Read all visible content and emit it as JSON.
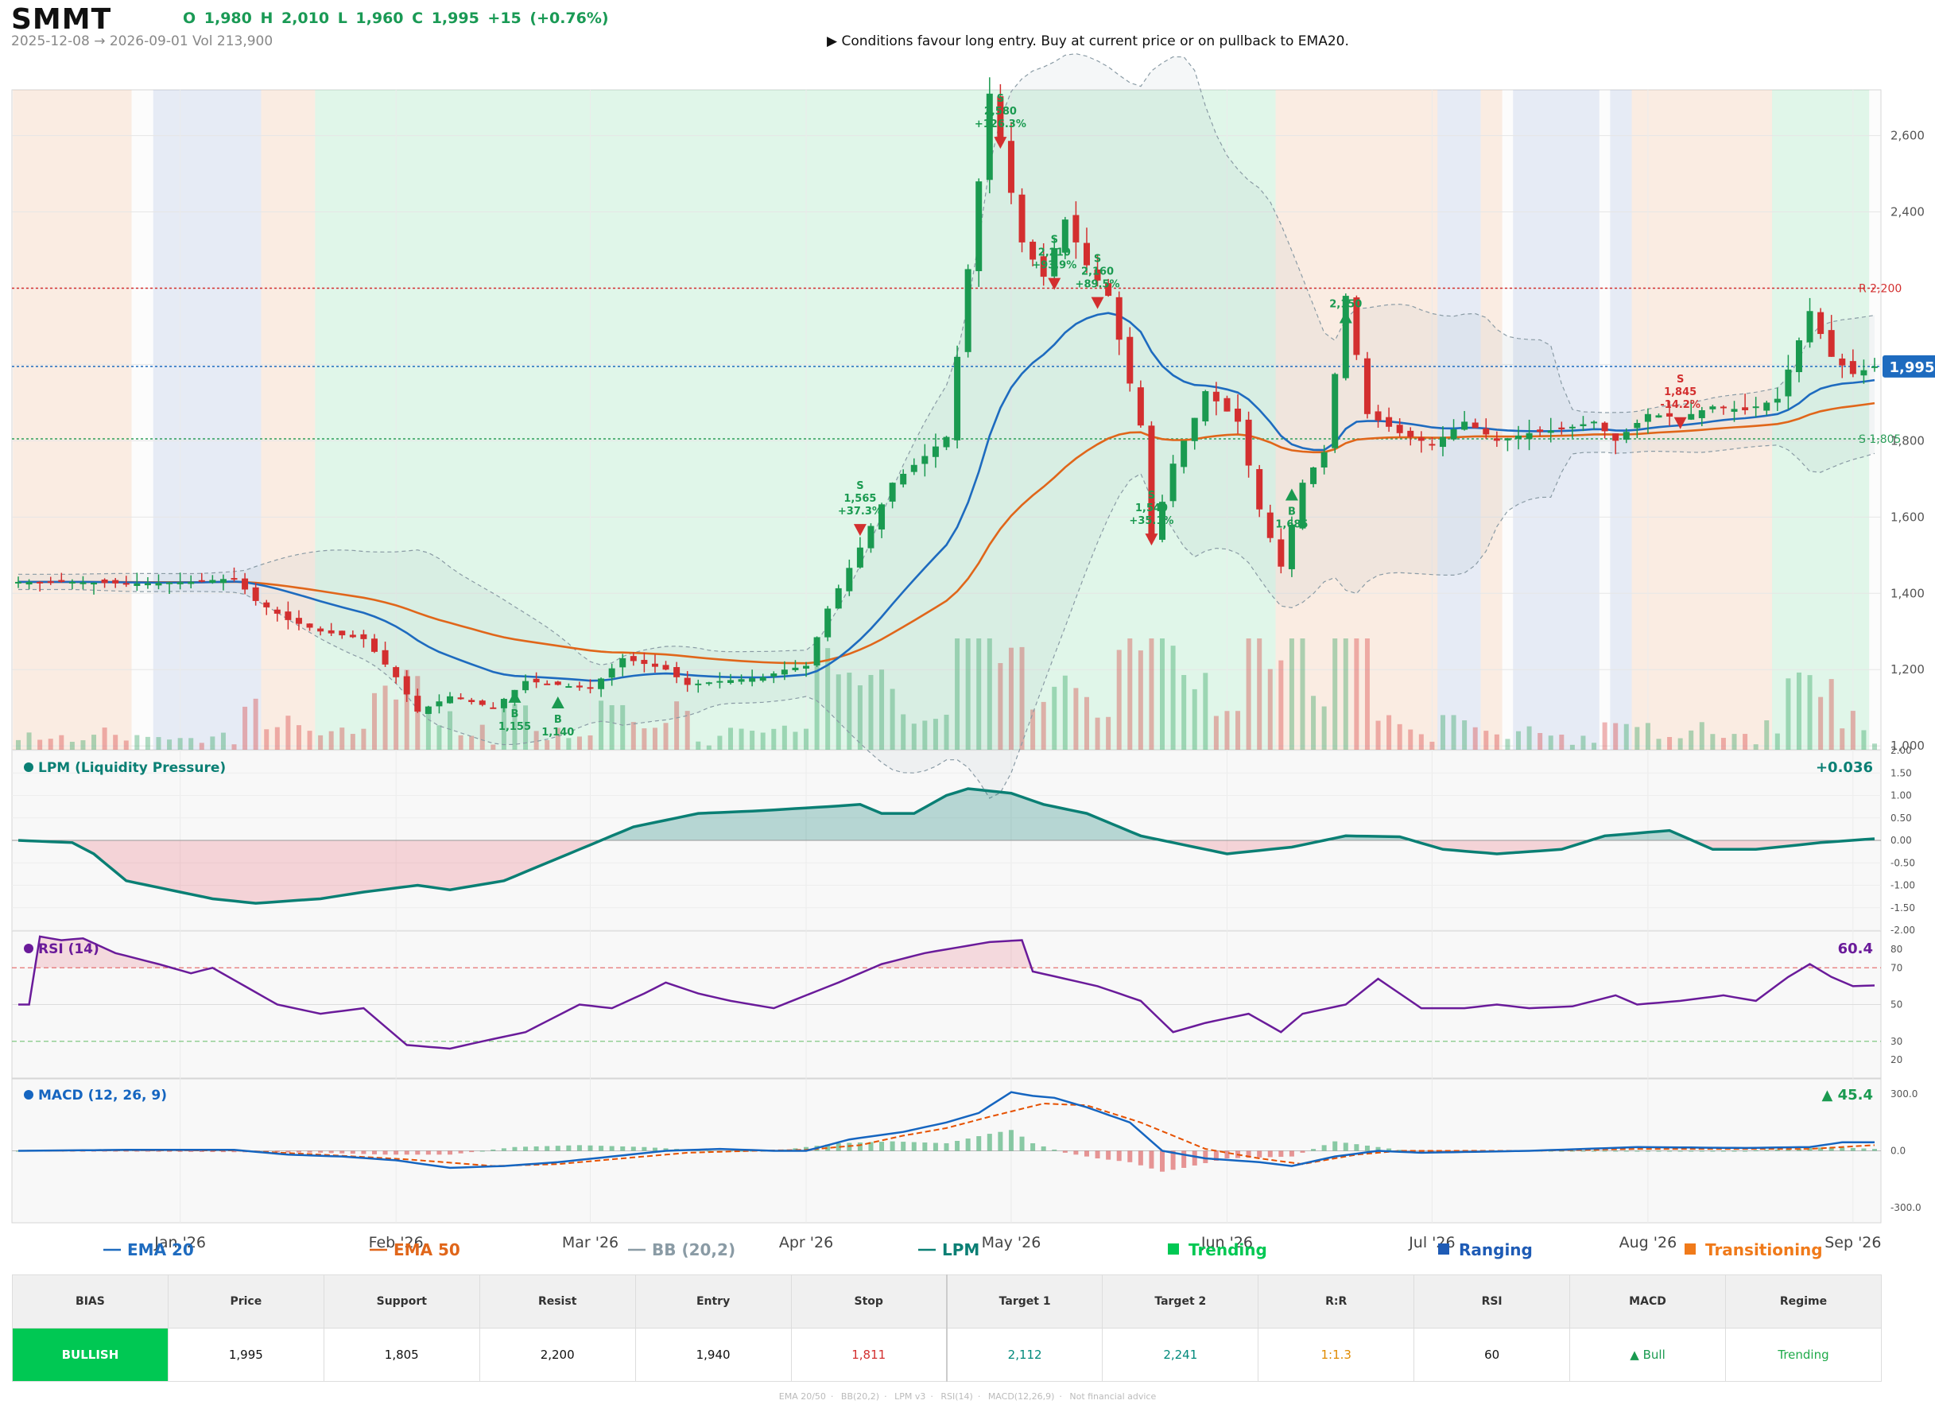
{
  "header": {
    "ticker": "SMMT",
    "ohlc": "O 1,980   H 2,010   L 1,960   C 1,995   +15  (+0.76%)",
    "subtitle": "2025-12-08 → 2026-09-01   Vol 213,900",
    "signal": "▶  Conditions favour long entry. Buy at current price or on pullback to EMA20."
  },
  "colors": {
    "up": "#1a9a50",
    "down": "#d32f2f",
    "ema20": "#1e6bbf",
    "ema50": "#e0661a",
    "bb": "#8a9ba5",
    "trending": "#00c853",
    "ranging": "#1e5bb5",
    "transitioning": "#f07a1a",
    "lpm": "#0a7f74",
    "rsi": "#6a1b9a",
    "macd": "#1565c0",
    "signal": "#e65100"
  },
  "chart_data": [
    {
      "type": "candlestick",
      "title": "SMMT",
      "x_ticks": [
        "Jan '26",
        "Feb '26",
        "Mar '26",
        "Apr '26",
        "May '26",
        "Jun '26",
        "Jul '26",
        "Aug '26",
        "Sep '26"
      ],
      "x_tick_index": [
        15,
        35,
        53,
        73,
        92,
        112,
        131,
        151,
        170
      ],
      "ylim": [
        990,
        2720
      ],
      "y_ticks": [
        1000,
        1200,
        1400,
        1600,
        1800,
        2000,
        2200,
        2400,
        2600
      ],
      "y_tick_labels": [
        "1,000",
        "1,200",
        "1,400",
        "1,600",
        "1,800",
        "",
        "",
        "2,400",
        "2,600"
      ],
      "num_bars": 173,
      "close_key": [
        [
          0,
          1430
        ],
        [
          5,
          1430
        ],
        [
          10,
          1425
        ],
        [
          16,
          1430
        ],
        [
          20,
          1440
        ],
        [
          22,
          1380
        ],
        [
          25,
          1330
        ],
        [
          28,
          1300
        ],
        [
          32,
          1280
        ],
        [
          35,
          1180
        ],
        [
          37,
          1090
        ],
        [
          40,
          1130
        ],
        [
          44,
          1100
        ],
        [
          47,
          1170
        ],
        [
          50,
          1160
        ],
        [
          53,
          1150
        ],
        [
          56,
          1230
        ],
        [
          60,
          1200
        ],
        [
          62,
          1160
        ],
        [
          65,
          1170
        ],
        [
          69,
          1180
        ],
        [
          71,
          1200
        ],
        [
          73,
          1210
        ],
        [
          75,
          1360
        ],
        [
          78,
          1520
        ],
        [
          81,
          1690
        ],
        [
          84,
          1760
        ],
        [
          86,
          1810
        ],
        [
          87,
          2020
        ],
        [
          90,
          2710
        ],
        [
          91,
          2580
        ],
        [
          93,
          2320
        ],
        [
          95,
          2230
        ],
        [
          97,
          2380
        ],
        [
          99,
          2260
        ],
        [
          101,
          2180
        ],
        [
          103,
          1950
        ],
        [
          104,
          1840
        ],
        [
          105,
          1540
        ],
        [
          107,
          1740
        ],
        [
          109,
          1860
        ],
        [
          110,
          1930
        ],
        [
          113,
          1850
        ],
        [
          115,
          1620
        ],
        [
          117,
          1470
        ],
        [
          119,
          1690
        ],
        [
          121,
          1770
        ],
        [
          123,
          2180
        ],
        [
          125,
          1870
        ],
        [
          128,
          1820
        ],
        [
          131,
          1790
        ],
        [
          134,
          1850
        ],
        [
          137,
          1800
        ],
        [
          140,
          1820
        ],
        [
          143,
          1830
        ],
        [
          146,
          1850
        ],
        [
          148,
          1800
        ],
        [
          151,
          1870
        ],
        [
          154,
          1860
        ],
        [
          157,
          1890
        ],
        [
          160,
          1880
        ],
        [
          163,
          1910
        ],
        [
          166,
          2140
        ],
        [
          168,
          2020
        ],
        [
          170,
          1975
        ],
        [
          172,
          1995
        ]
      ],
      "regimes": [
        [
          "Transitioning",
          0,
          10
        ],
        [
          "Ranging",
          13,
          22
        ],
        [
          "Transitioning",
          23,
          27
        ],
        [
          "Trending",
          28,
          116
        ],
        [
          "Transitioning",
          117,
          131
        ],
        [
          "Ranging",
          132,
          135
        ],
        [
          "Transitioning",
          136,
          137
        ],
        [
          "Ranging",
          139,
          146
        ],
        [
          "Ranging",
          148,
          149
        ],
        [
          "Transitioning",
          150,
          162
        ],
        [
          "Trending",
          163,
          171
        ]
      ],
      "levels": [
        {
          "label": "R 2,200",
          "value": 2200,
          "color": "#d32f2f"
        },
        {
          "label": "S 1,805",
          "value": 1805,
          "color": "#2e9e5b"
        },
        {
          "label": "1,995",
          "value": 1995,
          "color": "#1e6bbf"
        }
      ],
      "signals": [
        {
          "kind": "B",
          "label": "B",
          "price": "1,155",
          "pct": "",
          "index": 46,
          "value": 1155
        },
        {
          "kind": "B",
          "label": "B",
          "price": "1,140",
          "pct": "",
          "index": 50,
          "value": 1140
        },
        {
          "kind": "S",
          "label": "S",
          "price": "1,565",
          "pct": "+37.3%",
          "index": 78,
          "value": 1565
        },
        {
          "kind": "S",
          "label": "S",
          "price": "2,580",
          "pct": "+126.3%",
          "index": 91,
          "value": 2580
        },
        {
          "kind": "S",
          "label": "S",
          "price": "2,210",
          "pct": "+93.9%",
          "index": 96,
          "value": 2210
        },
        {
          "kind": "S",
          "label": "S",
          "price": "2,160",
          "pct": "+89.5%",
          "index": 100,
          "value": 2160
        },
        {
          "kind": "S",
          "label": "S",
          "price": "1,540",
          "pct": "+35.1%",
          "index": 105,
          "value": 1540
        },
        {
          "kind": "B",
          "label": "B",
          "price": "1,685",
          "pct": "",
          "index": 118,
          "value": 1685
        },
        {
          "kind": "B",
          "label": "",
          "price": "2,150",
          "pct": "",
          "index": 123,
          "value": 2150
        },
        {
          "kind": "S",
          "label": "S",
          "price": "1,845",
          "pct": "-14.2%",
          "index": 154,
          "value": 1845
        }
      ]
    },
    {
      "type": "area",
      "title": "LPM (Liquidity Pressure)",
      "last_value": "+0.036",
      "ylim": [
        -2.0,
        2.0
      ],
      "y_ticks": [
        -2.0,
        -1.5,
        -1.0,
        -0.5,
        0.0,
        0.5,
        1.0,
        1.5,
        2.0
      ],
      "y_tick_labels": [
        "-2.00",
        "-1.50",
        "-1.00",
        "-0.50",
        "0.00",
        "0.50",
        "1.00",
        "1.50",
        "2.00"
      ],
      "key": [
        [
          0,
          0
        ],
        [
          5,
          -0.05
        ],
        [
          7,
          -0.3
        ],
        [
          10,
          -0.9
        ],
        [
          14,
          -1.1
        ],
        [
          18,
          -1.3
        ],
        [
          22,
          -1.4
        ],
        [
          28,
          -1.3
        ],
        [
          32,
          -1.15
        ],
        [
          37,
          -1.0
        ],
        [
          40,
          -1.1
        ],
        [
          45,
          -0.9
        ],
        [
          50,
          -0.4
        ],
        [
          54,
          0
        ],
        [
          57,
          0.3
        ],
        [
          63,
          0.6
        ],
        [
          68,
          0.65
        ],
        [
          75,
          0.75
        ],
        [
          78,
          0.8
        ],
        [
          80,
          0.6
        ],
        [
          83,
          0.6
        ],
        [
          86,
          1.0
        ],
        [
          88,
          1.15
        ],
        [
          92,
          1.05
        ],
        [
          95,
          0.8
        ],
        [
          99,
          0.6
        ],
        [
          104,
          0.1
        ],
        [
          108,
          -0.1
        ],
        [
          112,
          -0.3
        ],
        [
          118,
          -0.15
        ],
        [
          123,
          0.1
        ],
        [
          128,
          0.08
        ],
        [
          132,
          -0.2
        ],
        [
          137,
          -0.3
        ],
        [
          143,
          -0.2
        ],
        [
          147,
          0.1
        ],
        [
          153,
          0.22
        ],
        [
          157,
          -0.2
        ],
        [
          161,
          -0.2
        ],
        [
          167,
          -0.05
        ],
        [
          172,
          0.036
        ]
      ]
    },
    {
      "type": "line",
      "title": "RSI (14)",
      "last_value": "60.4",
      "ylim": [
        10,
        90
      ],
      "y_ticks": [
        20,
        30,
        50,
        70,
        80
      ],
      "y_tick_labels": [
        "20",
        "30",
        "50",
        "70",
        "80"
      ],
      "key": [
        [
          0,
          50
        ],
        [
          1,
          50
        ],
        [
          2,
          87
        ],
        [
          4,
          85
        ],
        [
          6,
          86
        ],
        [
          9,
          78
        ],
        [
          13,
          72
        ],
        [
          16,
          67
        ],
        [
          18,
          70
        ],
        [
          21,
          60
        ],
        [
          24,
          50
        ],
        [
          28,
          45
        ],
        [
          32,
          48
        ],
        [
          36,
          28
        ],
        [
          40,
          26
        ],
        [
          43,
          30
        ],
        [
          47,
          35
        ],
        [
          52,
          50
        ],
        [
          55,
          48
        ],
        [
          58,
          56
        ],
        [
          60,
          62
        ],
        [
          63,
          56
        ],
        [
          66,
          52
        ],
        [
          70,
          48
        ],
        [
          73,
          55
        ],
        [
          76,
          62
        ],
        [
          80,
          72
        ],
        [
          84,
          78
        ],
        [
          86,
          80
        ],
        [
          90,
          84
        ],
        [
          93,
          85
        ],
        [
          94,
          68
        ],
        [
          97,
          64
        ],
        [
          100,
          60
        ],
        [
          104,
          52
        ],
        [
          107,
          35
        ],
        [
          110,
          40
        ],
        [
          114,
          45
        ],
        [
          117,
          35
        ],
        [
          119,
          45
        ],
        [
          123,
          50
        ],
        [
          126,
          64
        ],
        [
          130,
          48
        ],
        [
          134,
          48
        ],
        [
          137,
          50
        ],
        [
          140,
          48
        ],
        [
          144,
          49
        ],
        [
          148,
          55
        ],
        [
          150,
          50
        ],
        [
          154,
          52
        ],
        [
          158,
          55
        ],
        [
          161,
          52
        ],
        [
          164,
          65
        ],
        [
          166,
          72
        ],
        [
          168,
          65
        ],
        [
          170,
          60
        ],
        [
          172,
          60.4
        ]
      ]
    },
    {
      "type": "line",
      "title": "MACD (12, 26, 9)",
      "last_value": "▲ 45.4",
      "ylim": [
        -380,
        380
      ],
      "y_ticks": [
        -300,
        0,
        300
      ],
      "y_tick_labels": [
        "-300.0",
        "0.0",
        "300.0"
      ],
      "macd_key": [
        [
          0,
          0
        ],
        [
          10,
          5
        ],
        [
          20,
          5
        ],
        [
          25,
          -20
        ],
        [
          30,
          -30
        ],
        [
          35,
          -50
        ],
        [
          40,
          -90
        ],
        [
          45,
          -80
        ],
        [
          50,
          -60
        ],
        [
          55,
          -30
        ],
        [
          60,
          0
        ],
        [
          65,
          10
        ],
        [
          70,
          0
        ],
        [
          73,
          0
        ],
        [
          77,
          60
        ],
        [
          82,
          100
        ],
        [
          86,
          150
        ],
        [
          89,
          200
        ],
        [
          92,
          310
        ],
        [
          94,
          290
        ],
        [
          96,
          280
        ],
        [
          99,
          230
        ],
        [
          103,
          150
        ],
        [
          106,
          0
        ],
        [
          110,
          -40
        ],
        [
          115,
          -60
        ],
        [
          118,
          -80
        ],
        [
          122,
          -30
        ],
        [
          126,
          0
        ],
        [
          130,
          -10
        ],
        [
          140,
          0
        ],
        [
          150,
          20
        ],
        [
          160,
          15
        ],
        [
          166,
          20
        ],
        [
          169,
          45
        ],
        [
          172,
          45.4
        ]
      ],
      "signal_key": [
        [
          0,
          0
        ],
        [
          10,
          3
        ],
        [
          20,
          2
        ],
        [
          28,
          -20
        ],
        [
          36,
          -45
        ],
        [
          44,
          -80
        ],
        [
          50,
          -70
        ],
        [
          56,
          -40
        ],
        [
          62,
          -10
        ],
        [
          68,
          0
        ],
        [
          73,
          5
        ],
        [
          78,
          30
        ],
        [
          82,
          80
        ],
        [
          86,
          120
        ],
        [
          90,
          180
        ],
        [
          95,
          250
        ],
        [
          99,
          240
        ],
        [
          104,
          150
        ],
        [
          107,
          80
        ],
        [
          110,
          10
        ],
        [
          115,
          -40
        ],
        [
          119,
          -70
        ],
        [
          124,
          -20
        ],
        [
          128,
          0
        ],
        [
          140,
          0
        ],
        [
          150,
          10
        ],
        [
          160,
          10
        ],
        [
          166,
          10
        ],
        [
          172,
          30
        ]
      ],
      "hist_key": [
        [
          0,
          0
        ],
        [
          28,
          -10
        ],
        [
          34,
          -20
        ],
        [
          40,
          -20
        ],
        [
          46,
          20
        ],
        [
          52,
          30
        ],
        [
          58,
          20
        ],
        [
          64,
          0
        ],
        [
          70,
          0
        ],
        [
          76,
          40
        ],
        [
          81,
          50
        ],
        [
          86,
          40
        ],
        [
          90,
          90
        ],
        [
          92,
          110
        ],
        [
          94,
          40
        ],
        [
          97,
          -10
        ],
        [
          100,
          -40
        ],
        [
          103,
          -60
        ],
        [
          106,
          -110
        ],
        [
          108,
          -90
        ],
        [
          112,
          -40
        ],
        [
          118,
          -30
        ],
        [
          122,
          50
        ],
        [
          126,
          20
        ],
        [
          130,
          -10
        ],
        [
          140,
          0
        ],
        [
          160,
          0
        ],
        [
          168,
          20
        ],
        [
          172,
          10
        ]
      ]
    }
  ],
  "legend": [
    {
      "label": "EMA 20",
      "swatch": "line",
      "color": "#1e6bbf"
    },
    {
      "label": "EMA 50",
      "swatch": "line",
      "color": "#e0661a"
    },
    {
      "label": "BB (20,2)",
      "swatch": "line",
      "color": "#8a9ba5"
    },
    {
      "label": "LPM",
      "swatch": "line",
      "color": "#0a7f74"
    },
    {
      "label": "Trending",
      "swatch": "box",
      "color": "#00c853"
    },
    {
      "label": "Ranging",
      "swatch": "box",
      "color": "#1e5bb5"
    },
    {
      "label": "Transitioning",
      "swatch": "box",
      "color": "#f07a1a"
    }
  ],
  "table": {
    "headers": [
      "BIAS",
      "Price",
      "Support",
      "Resist",
      "Entry",
      "Stop",
      "Target 1",
      "Target 2",
      "R:R",
      "RSI",
      "MACD",
      "Regime"
    ],
    "values": [
      "BULLISH",
      "1,995",
      "1,805",
      "2,200",
      "1,940",
      "1,811",
      "2,112",
      "2,241",
      "1:1.3",
      "60",
      "▲ Bull",
      "Trending"
    ],
    "value_colors": [
      "#ffffff",
      "#111111",
      "#111111",
      "#111111",
      "#111111",
      "#d32f2f",
      "#00897b",
      "#00897b",
      "#e08a00",
      "#111111",
      "#1a9a50",
      "#1faa4a"
    ]
  },
  "footer": [
    "EMA 20/50",
    "BB(20,2)",
    "LPM v3",
    "RSI(14)",
    "MACD(12,26,9)",
    "Not financial advice"
  ]
}
